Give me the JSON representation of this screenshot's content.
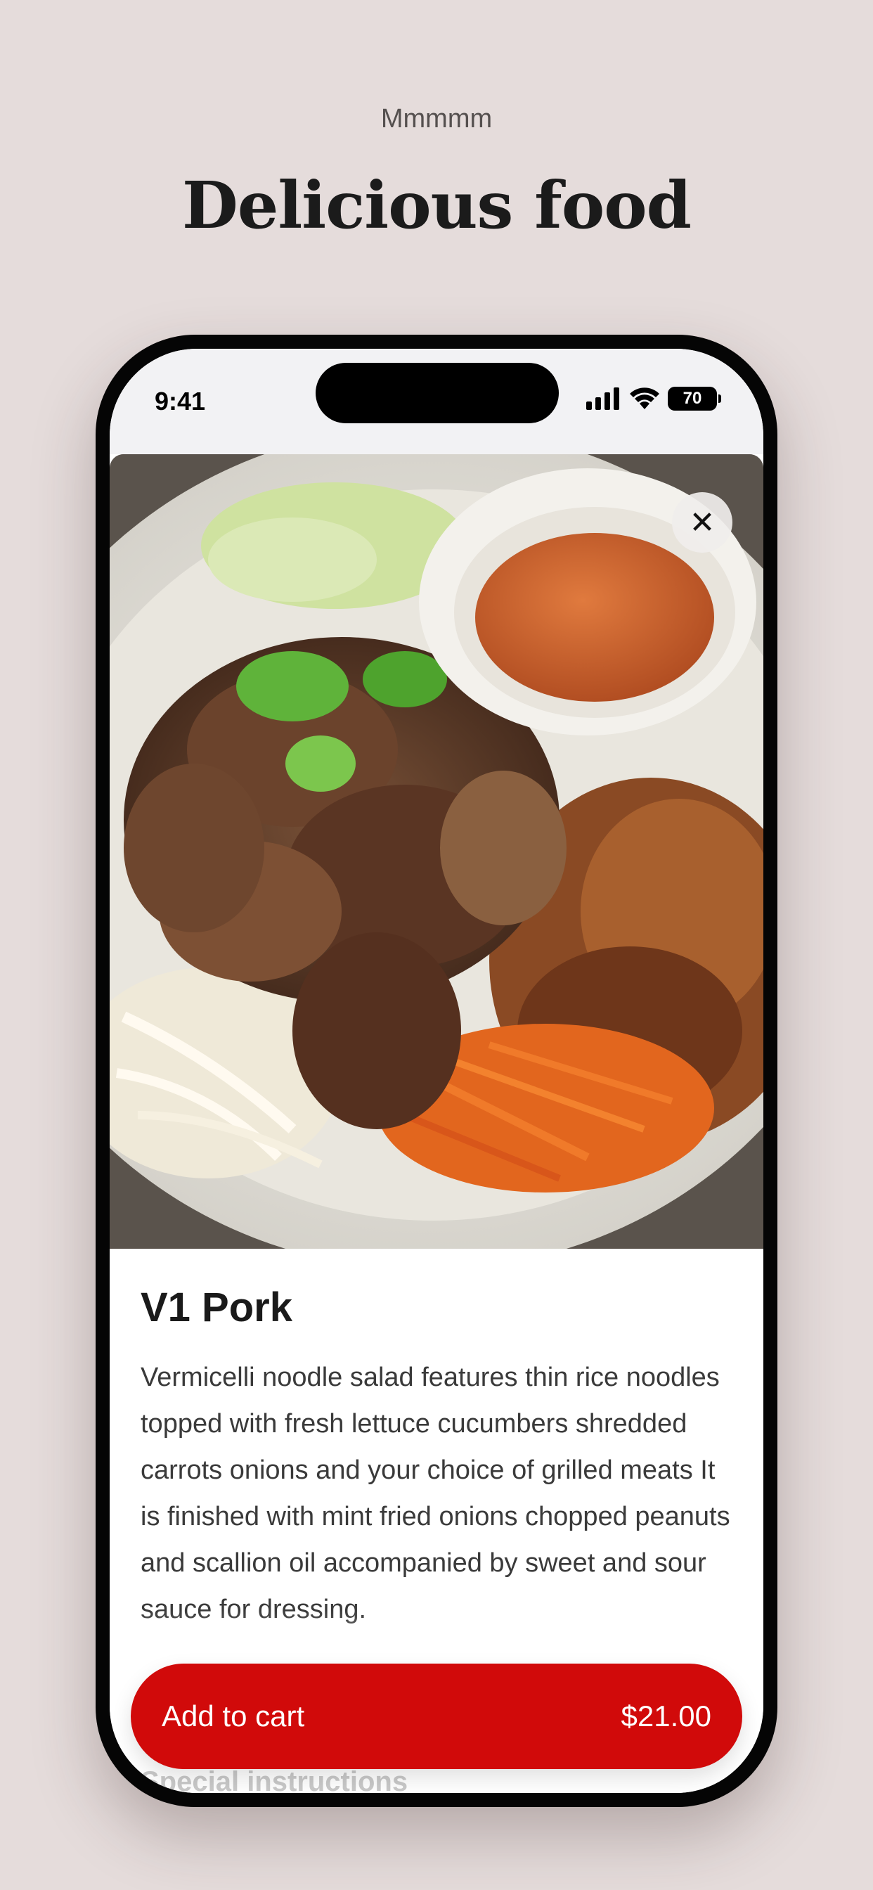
{
  "page": {
    "eyebrow": "Mmmmm",
    "headline": "Delicious food"
  },
  "status_bar": {
    "time": "9:41",
    "battery": "70"
  },
  "product": {
    "name": "V1 Pork",
    "description": "Vermicelli noodle salad features thin rice noodles topped with fresh lettuce cucumbers shredded carrots onions and your choice of grilled meats It is finished with mint fried onions chopped peanuts and scallion oil accompanied by sweet and sour sauce for dressing.",
    "special_instructions_label": "Special instructions"
  },
  "cart": {
    "label": "Add to cart",
    "price": "$21.00"
  },
  "colors": {
    "background": "#e5dcdb",
    "accent": "#d10a0a"
  },
  "icons": [
    "signal-icon",
    "wifi-icon",
    "battery-icon",
    "close-icon"
  ]
}
